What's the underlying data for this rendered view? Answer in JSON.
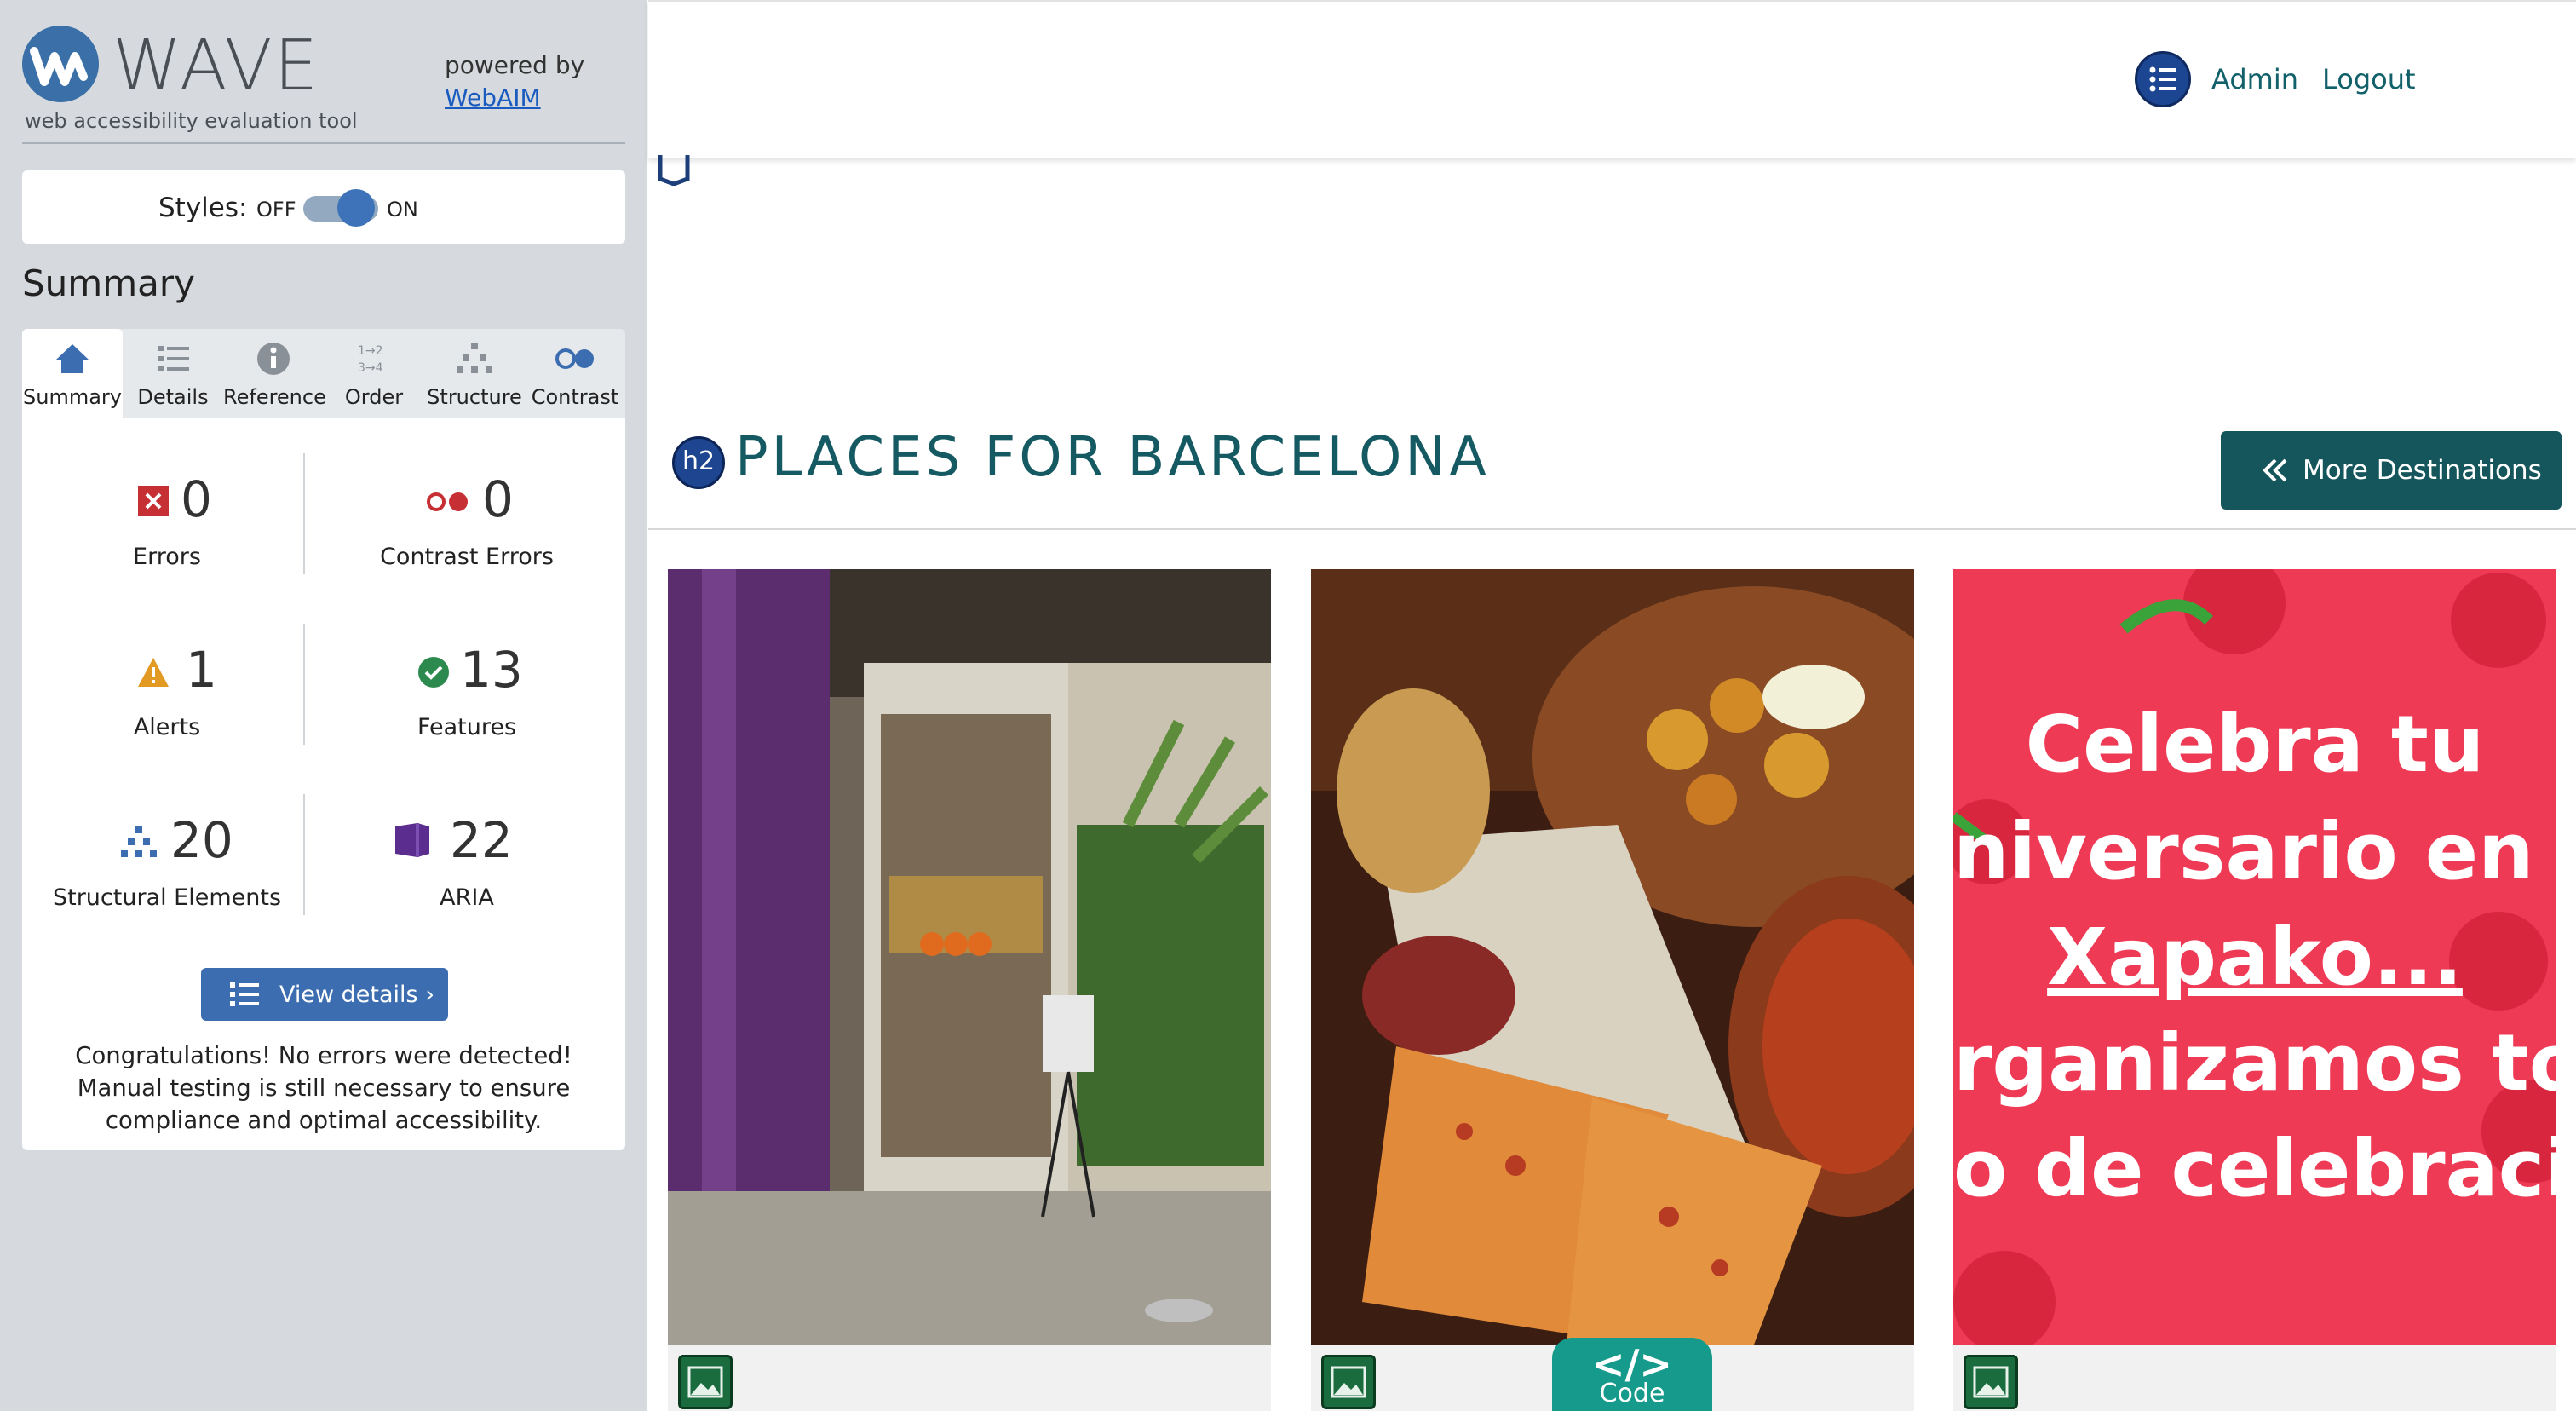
{
  "wave": {
    "name": "WAVE",
    "tagline": "web accessibility evaluation tool",
    "powered_by": "powered by",
    "webaim": "WebAIM",
    "styles_label": "Styles:",
    "styles_off": "OFF",
    "styles_on": "ON",
    "summary_heading": "Summary",
    "tabs": [
      {
        "label": "Summary",
        "icon": "home-icon",
        "active": true
      },
      {
        "label": "Details",
        "icon": "list-icon"
      },
      {
        "label": "Reference",
        "icon": "info-icon"
      },
      {
        "label": "Order",
        "icon": "order-icon"
      },
      {
        "label": "Structure",
        "icon": "structure-icon"
      },
      {
        "label": "Contrast",
        "icon": "contrast-icon"
      }
    ],
    "stats": {
      "errors": {
        "value": "0",
        "label": "Errors"
      },
      "contrast_errors": {
        "value": "0",
        "label": "Contrast Errors"
      },
      "alerts": {
        "value": "1",
        "label": "Alerts"
      },
      "features": {
        "value": "13",
        "label": "Features"
      },
      "structural": {
        "value": "20",
        "label": "Structural Elements"
      },
      "aria": {
        "value": "22",
        "label": "ARIA"
      }
    },
    "view_details": "View details ›",
    "congrats": "Congratulations! No errors were detected! Manual testing is still necessary to ensure compliance and optimal accessibility."
  },
  "page": {
    "nav": {
      "admin": "Admin",
      "logout": "Logout"
    },
    "h2_badge": "h2",
    "section_title": "PLACES FOR BARCELONA",
    "more_destinations": "More Destinations",
    "promo_lines": [
      "Celebra tu",
      "niversario en B",
      "Xapako...",
      "rganizamos to",
      "o de celebracio"
    ],
    "code_tab": {
      "glyph": "</>",
      "label": "Code"
    }
  },
  "colors": {
    "sidebar_bg": "#d6dade",
    "wave_blue": "#3c6db0",
    "title_teal": "#155a63",
    "button_teal": "#15565d",
    "promo_red": "#ee3a55"
  }
}
